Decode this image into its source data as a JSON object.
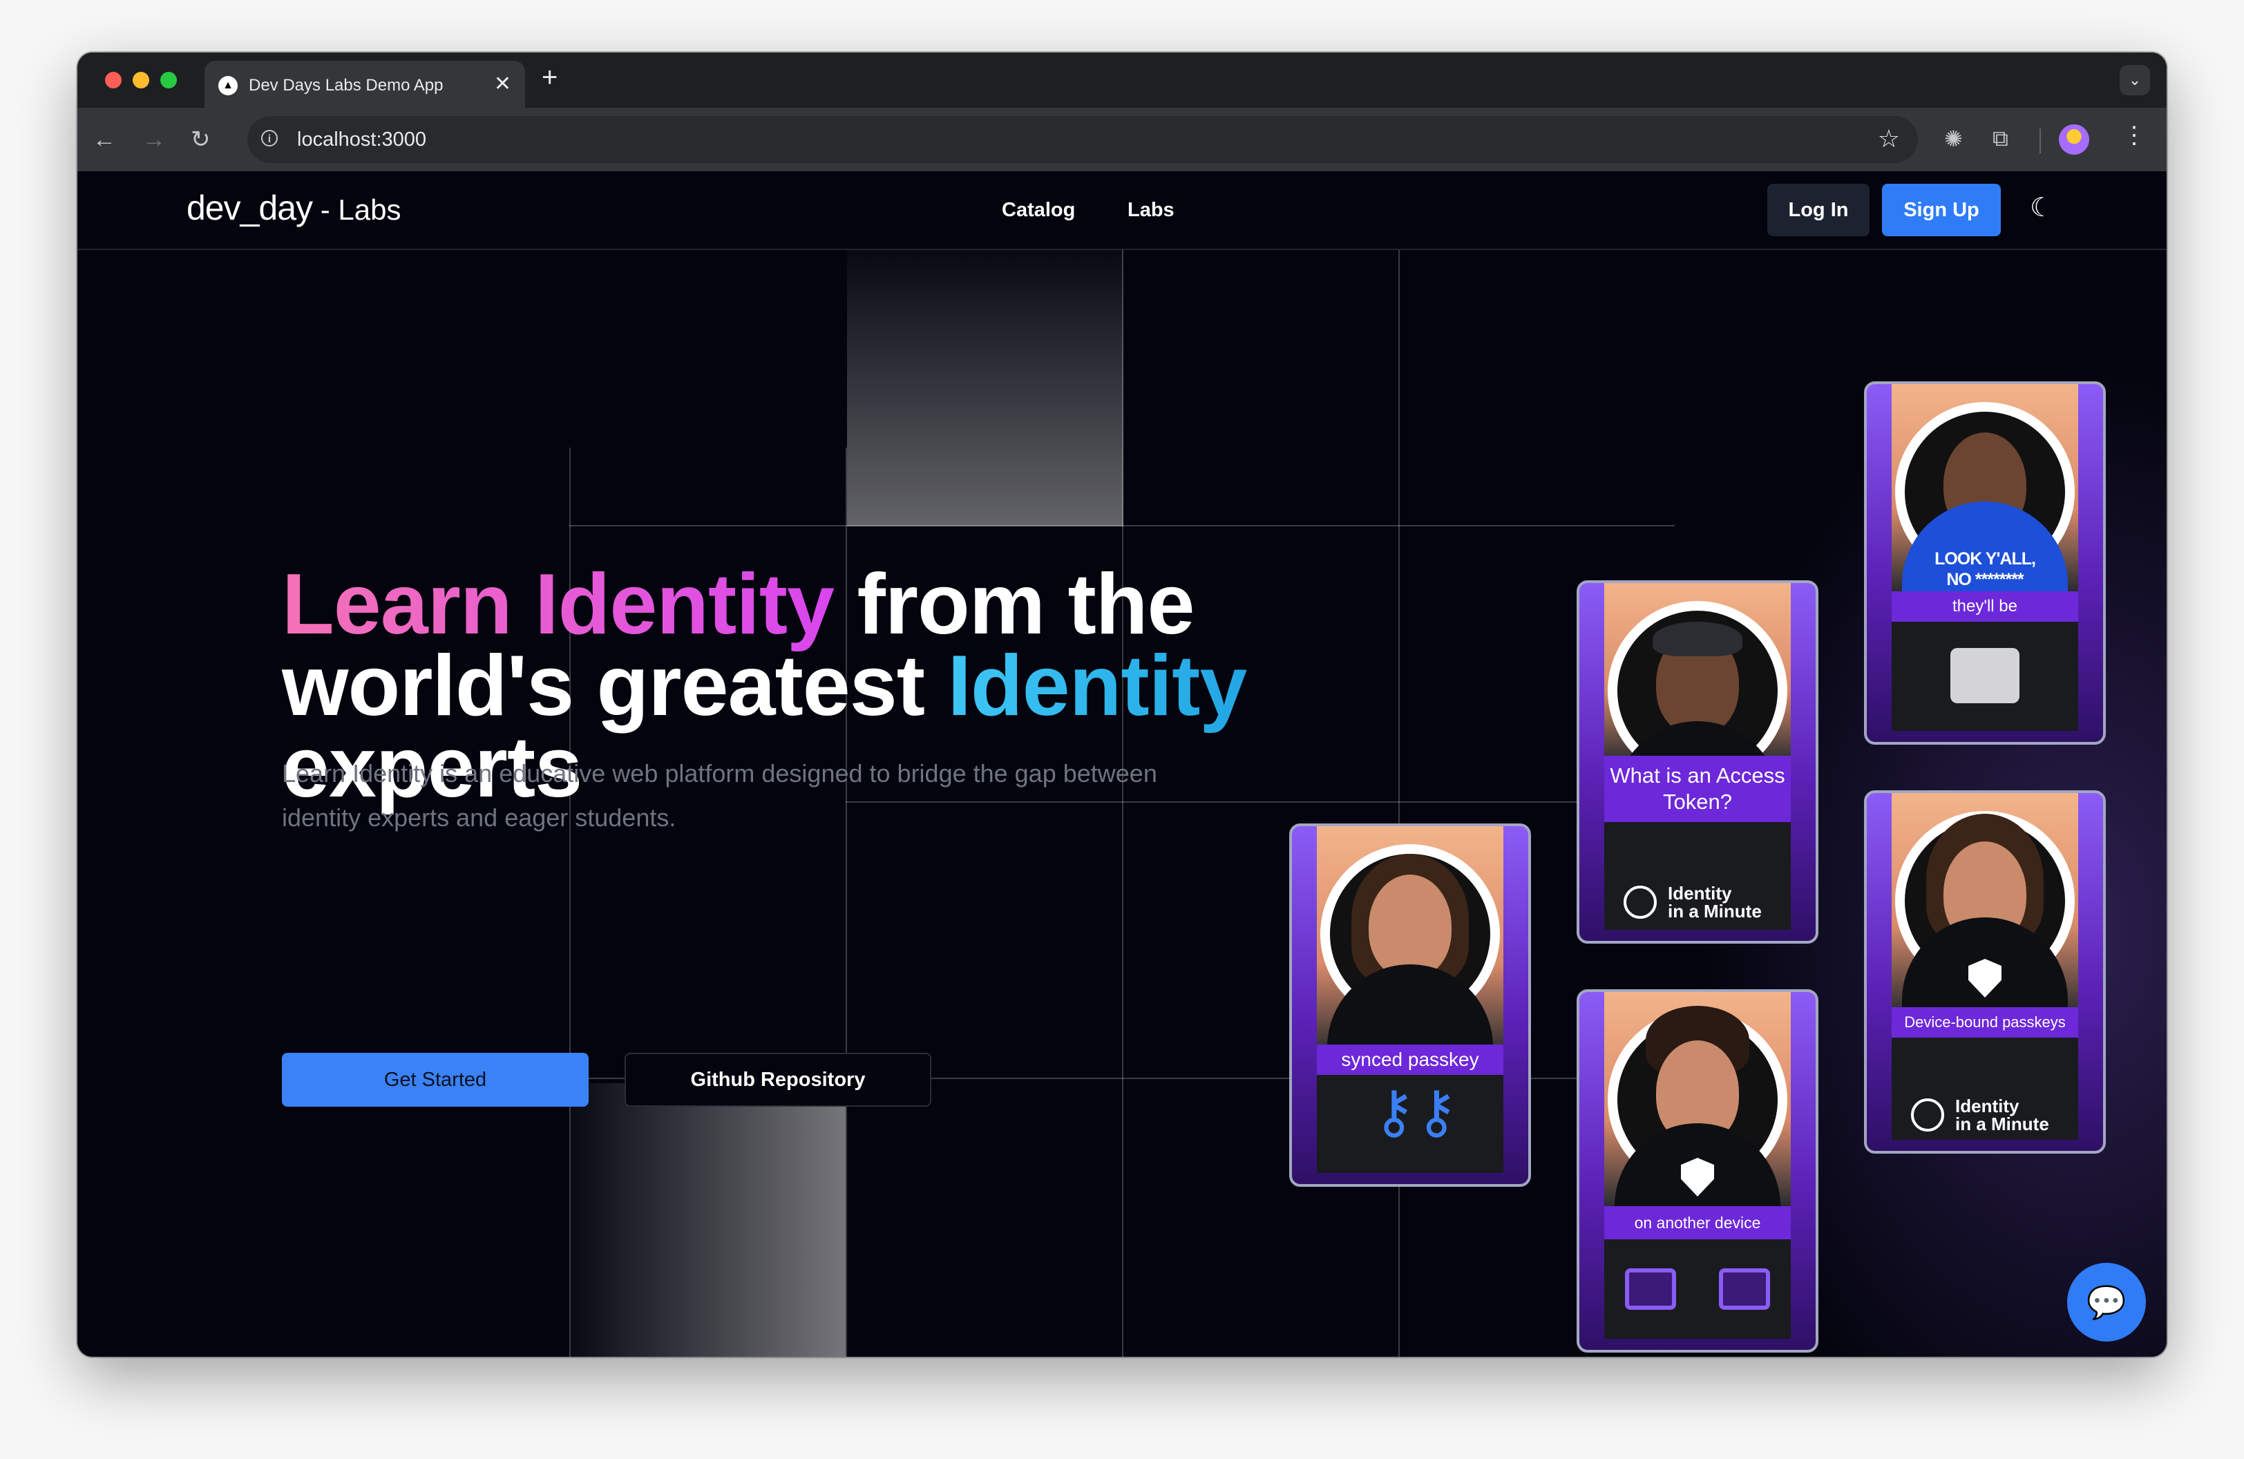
{
  "browser": {
    "tab_title": "Dev Days Labs Demo App",
    "tab_close": "✕",
    "new_tab": "+",
    "tab_menu": "⌄",
    "url": "localhost:3000",
    "icons": {
      "back": "←",
      "forward": "→",
      "reload": "↻",
      "info": "i",
      "bookmark": "☆",
      "extension_1": "✺",
      "extension_2": "⧉",
      "menu": "⋮"
    }
  },
  "site": {
    "logo": "dev_day",
    "logo_suffix": " - Labs",
    "nav": [
      {
        "label": "Catalog"
      },
      {
        "label": "Labs"
      }
    ],
    "login_label": "Log In",
    "signup_label": "Sign Up",
    "theme_icon": "☾"
  },
  "hero": {
    "title_part1": "Learn Identity",
    "title_part2": " from the world's greatest ",
    "title_part3": "Identity",
    "title_part4": " experts",
    "description": "Learn Identity is an educative web platform designed to bridge the gap between identity experts and eager students.",
    "get_started_label": "Get Started",
    "github_label": "Github Repository"
  },
  "cards": {
    "card1": {
      "caption": "synced passkey"
    },
    "card2": {
      "caption": "What is an Access Token?",
      "badge_line1": "Identity",
      "badge_line2": "in a Minute"
    },
    "card3": {
      "tshirt_line1": "LOOK Y'ALL,",
      "tshirt_line2": "NO ********",
      "caption": "they'll be"
    },
    "card4": {
      "caption": "on another device"
    },
    "card5": {
      "caption": "Device-bound passkeys",
      "badge_line1": "Identity",
      "badge_line2": "in a Minute"
    }
  },
  "chat_icon": "💬",
  "colors": {
    "accent_blue": "#2f7cf6",
    "page_background": "#03040d",
    "title_pink": "#f472b6",
    "title_blue": "#3ec6f5",
    "card_purple": "#6d28d9"
  }
}
